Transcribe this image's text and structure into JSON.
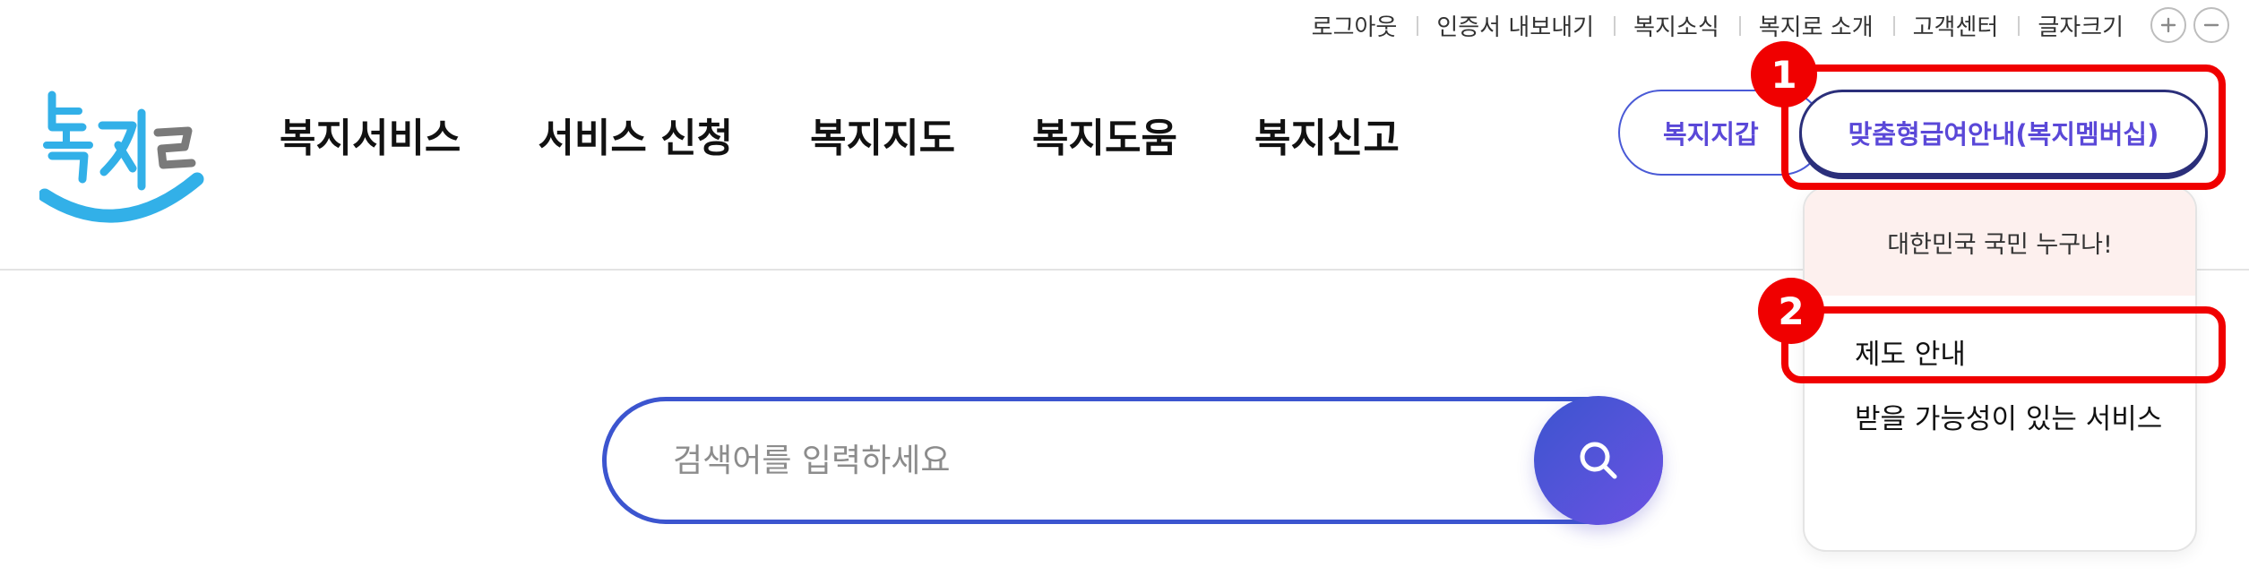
{
  "utility_bar": {
    "items": [
      "로그아웃",
      "인증서 내보내기",
      "복지소식",
      "복지로 소개",
      "고객센터",
      "글자크기"
    ],
    "font_increase_icon": "plus-icon",
    "font_decrease_icon": "minus-icon"
  },
  "logo": {
    "text": "복지로",
    "colors": {
      "text": "#32b0e8",
      "accent": "#7a7a7a",
      "smile": "#32b0e8"
    }
  },
  "gnb": {
    "items": [
      "복지서비스",
      "서비스 신청",
      "복지지도",
      "복지도움",
      "복지신고"
    ]
  },
  "header_buttons": {
    "wallet": "복지지갑",
    "membership": "맞춤형급여안내(복지멤버십)"
  },
  "dropdown": {
    "header": "대한민국 국민 누구나!",
    "items": [
      "제도 안내",
      "받을 가능성이 있는 서비스"
    ]
  },
  "search": {
    "placeholder": "검색어를 입력하세요",
    "button_icon": "search-icon"
  },
  "annotations": {
    "badges": [
      "1",
      "2"
    ],
    "color": "#f00000"
  },
  "colors": {
    "primary": "#3c55cf",
    "purple": "#5a48d8",
    "dropdown_head_bg": "#fdf0ee"
  }
}
